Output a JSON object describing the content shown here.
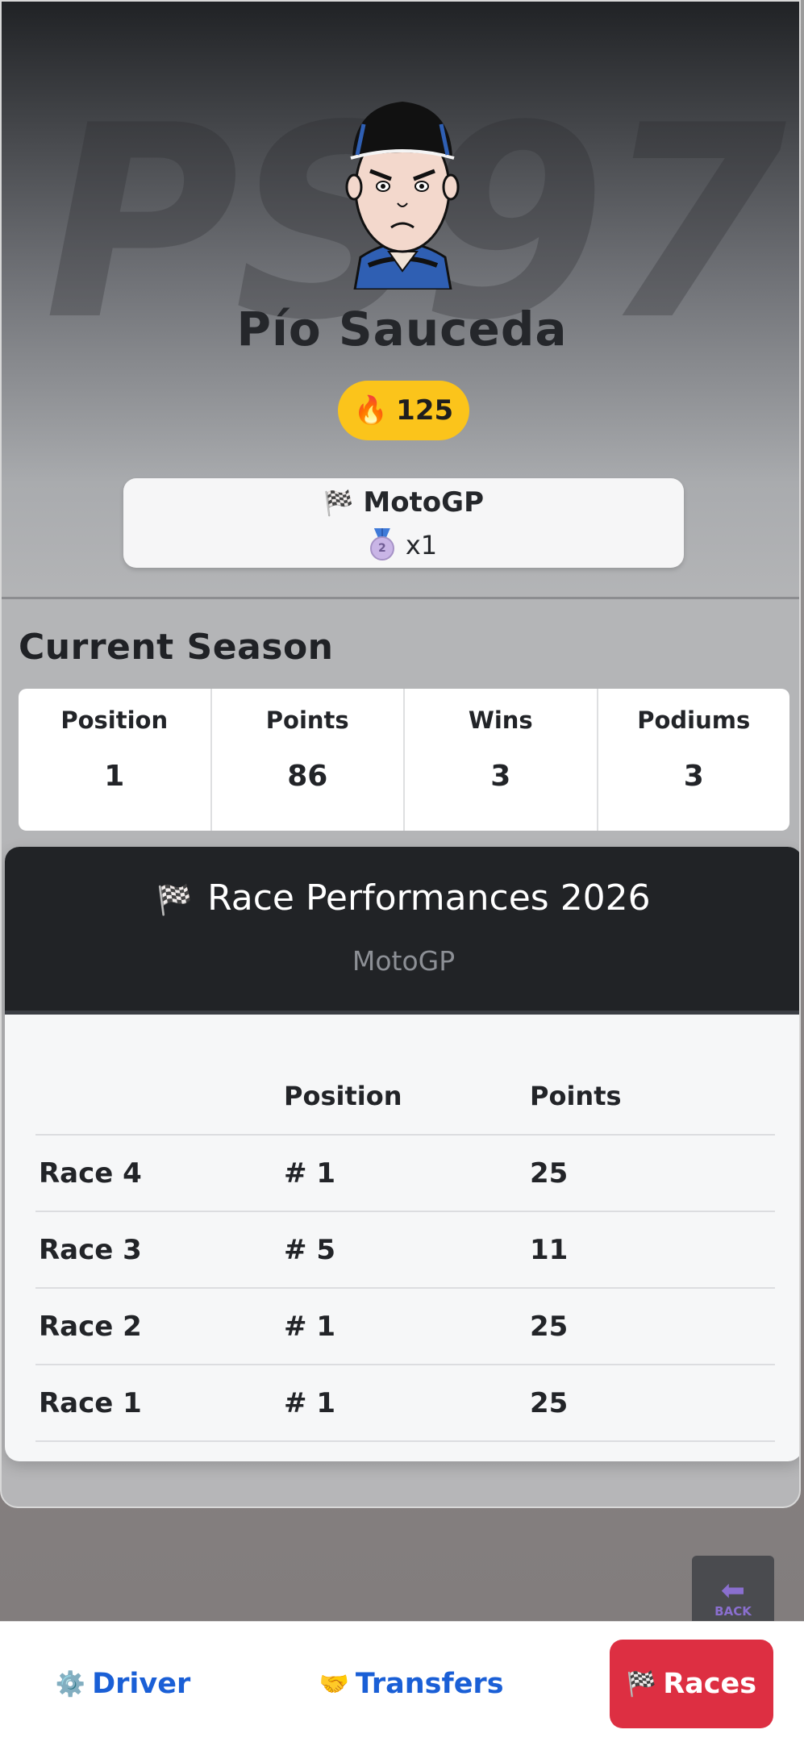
{
  "driver": {
    "watermark": "PS97",
    "name": "Pío Sauceda",
    "fire_icon": "🔥",
    "fire_count": "125"
  },
  "championship": {
    "flag_icon": "🏁",
    "name": "MotoGP",
    "medal_icon": "2",
    "medal_count": "x1"
  },
  "season": {
    "title": "Current Season",
    "stats": [
      {
        "label": "Position",
        "value": "1"
      },
      {
        "label": "Points",
        "value": "86"
      },
      {
        "label": "Wins",
        "value": "3"
      },
      {
        "label": "Podiums",
        "value": "3"
      }
    ]
  },
  "races": {
    "flag_icon": "🏁",
    "title": "Race Performances 2026",
    "subtitle": "MotoGP",
    "headers": [
      "",
      "Position",
      "Points"
    ],
    "rows": [
      {
        "race": "Race 4",
        "position": "# 1",
        "points": "25"
      },
      {
        "race": "Race 3",
        "position": "# 5",
        "points": "11"
      },
      {
        "race": "Race 2",
        "position": "# 1",
        "points": "25"
      },
      {
        "race": "Race 1",
        "position": "# 1",
        "points": "25"
      }
    ]
  },
  "back_button": {
    "arrow": "⬅",
    "label": "BACK"
  },
  "nav": {
    "driver_icon": "⚙️",
    "driver": "Driver",
    "transfers_icon": "🤝",
    "transfers": "Transfers",
    "races_icon": "🏁",
    "races": "Races"
  }
}
